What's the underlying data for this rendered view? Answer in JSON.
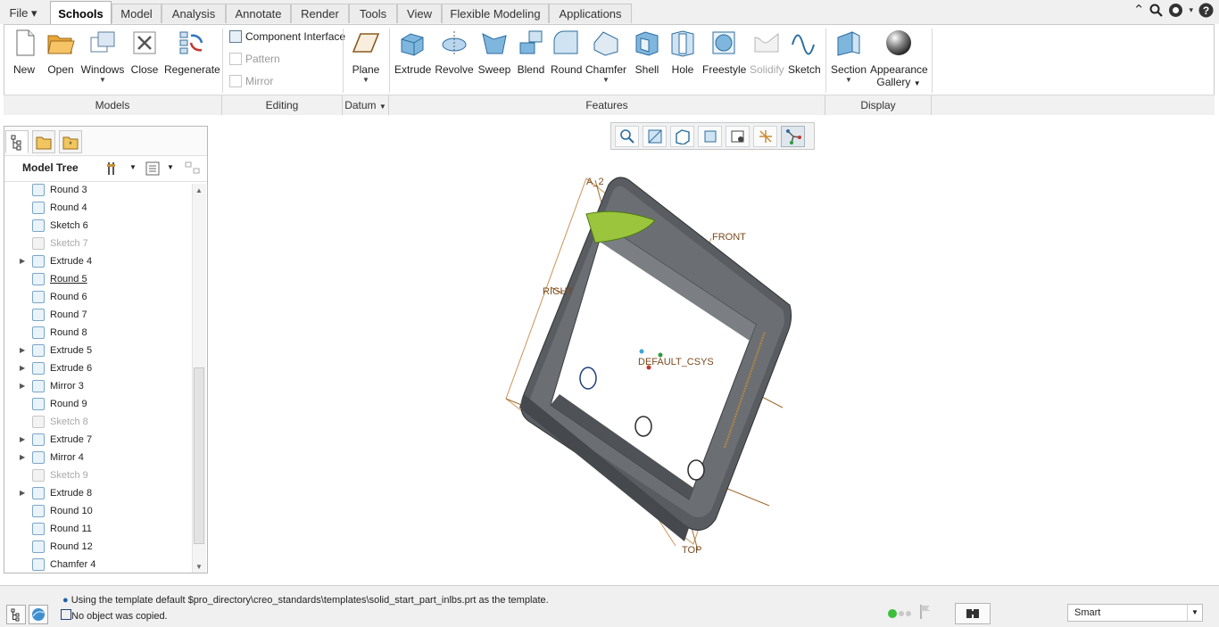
{
  "tabs": [
    {
      "label": "File ▾",
      "active": false
    },
    {
      "label": "Schools",
      "active": true
    },
    {
      "label": "Model",
      "active": false
    },
    {
      "label": "Analysis",
      "active": false
    },
    {
      "label": "Annotate",
      "active": false
    },
    {
      "label": "Render",
      "active": false
    },
    {
      "label": "Tools",
      "active": false
    },
    {
      "label": "View",
      "active": false
    },
    {
      "label": "Flexible Modeling",
      "active": false
    },
    {
      "label": "Applications",
      "active": false
    }
  ],
  "ribbon": {
    "models": {
      "new": "New",
      "open": "Open",
      "windows": "Windows",
      "close": "Close",
      "regenerate": "Regenerate"
    },
    "editing": {
      "component_interface": "Component Interface",
      "pattern": "Pattern",
      "mirror": "Mirror"
    },
    "datum": {
      "plane": "Plane"
    },
    "features": {
      "extrude": "Extrude",
      "revolve": "Revolve",
      "sweep": "Sweep",
      "blend": "Blend",
      "round": "Round",
      "chamfer": "Chamfer",
      "shell": "Shell",
      "hole": "Hole",
      "freestyle": "Freestyle",
      "solidify": "Solidify",
      "sketch": "Sketch"
    },
    "display": {
      "section": "Section",
      "appearance_1": "Appearance",
      "appearance_2": "Gallery"
    },
    "group_labels": {
      "models": "Models",
      "editing": "Editing",
      "datum": "Datum",
      "features": "Features",
      "display": "Display"
    }
  },
  "model_tree": {
    "title": "Model Tree",
    "items": [
      {
        "label": "Round 3",
        "expandable": false,
        "dim": false
      },
      {
        "label": "Round 4",
        "expandable": false,
        "dim": false
      },
      {
        "label": "Sketch 6",
        "expandable": false,
        "dim": false
      },
      {
        "label": "Sketch 7",
        "expandable": false,
        "dim": true
      },
      {
        "label": "Extrude 4",
        "expandable": true,
        "dim": false
      },
      {
        "label": "Round 5",
        "expandable": false,
        "dim": false,
        "underline": true
      },
      {
        "label": "Round 6",
        "expandable": false,
        "dim": false
      },
      {
        "label": "Round 7",
        "expandable": false,
        "dim": false
      },
      {
        "label": "Round 8",
        "expandable": false,
        "dim": false
      },
      {
        "label": "Extrude 5",
        "expandable": true,
        "dim": false
      },
      {
        "label": "Extrude 6",
        "expandable": true,
        "dim": false
      },
      {
        "label": "Mirror 3",
        "expandable": true,
        "dim": false
      },
      {
        "label": "Round 9",
        "expandable": false,
        "dim": false
      },
      {
        "label": "Sketch 8",
        "expandable": false,
        "dim": true
      },
      {
        "label": "Extrude 7",
        "expandable": true,
        "dim": false
      },
      {
        "label": "Mirror 4",
        "expandable": true,
        "dim": false
      },
      {
        "label": "Sketch 9",
        "expandable": false,
        "dim": true
      },
      {
        "label": "Extrude 8",
        "expandable": true,
        "dim": false
      },
      {
        "label": "Round 10",
        "expandable": false,
        "dim": false
      },
      {
        "label": "Round 11",
        "expandable": false,
        "dim": false
      },
      {
        "label": "Round 12",
        "expandable": false,
        "dim": false
      },
      {
        "label": "Chamfer 4",
        "expandable": false,
        "dim": false
      }
    ]
  },
  "datum_labels": {
    "a2": "A_2",
    "front": "FRONT",
    "right": "RIGHT",
    "csys": "DEFAULT_CSYS",
    "top": "TOP"
  },
  "status": {
    "message_1": "Using the template default $pro_directory\\creo_standards\\templates\\solid_start_part_inlbs.prt as the template.",
    "message_2": "No object was copied.",
    "filter": "Smart"
  }
}
